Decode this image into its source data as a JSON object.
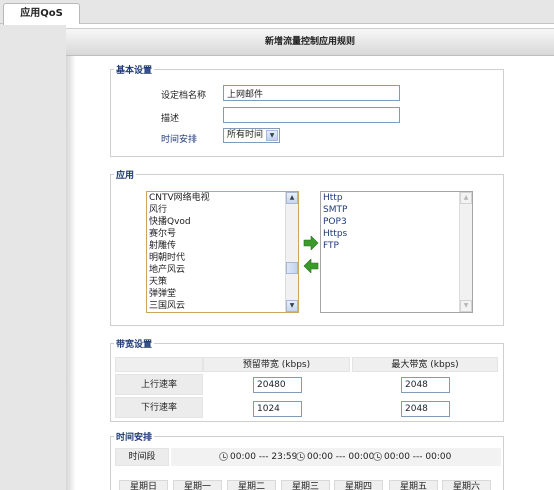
{
  "tab": {
    "label": "应用QoS"
  },
  "title": "新增流量控制应用规则",
  "basic": {
    "section_title": "基本设置",
    "name_label": "设定档名称",
    "name_value": "上网邮件",
    "desc_label": "描述",
    "desc_value": "",
    "schedule_label": "时间安排",
    "schedule_value": "所有时间"
  },
  "app": {
    "section_title": "应用",
    "available": [
      "CNTV网络电视",
      "风行",
      "快播Qvod",
      "赛尔号",
      "射雕传",
      "明朝时代",
      "地产风云",
      "天策",
      "弹弹堂",
      "三国风云"
    ],
    "selected": [
      "Http",
      "SMTP",
      "POP3",
      "Https",
      "FTP"
    ]
  },
  "bandwidth": {
    "section_title": "带宽设置",
    "col_reserved": "预留带宽 (kbps)",
    "col_max": "最大带宽 (kbps)",
    "rows": [
      {
        "label": "上行速率",
        "reserved": "20480",
        "max": "2048"
      },
      {
        "label": "下行速率",
        "reserved": "1024",
        "max": "2048"
      }
    ]
  },
  "schedule": {
    "section_title": "时间安排",
    "period_label": "时间段",
    "ranges": [
      "00:00 --- 23:59",
      "00:00 --- 00:00",
      "00:00 --- 00:00"
    ],
    "days": [
      "星期日",
      "星期一",
      "星期二",
      "星期三",
      "星期四",
      "星期五",
      "星期六"
    ]
  }
}
